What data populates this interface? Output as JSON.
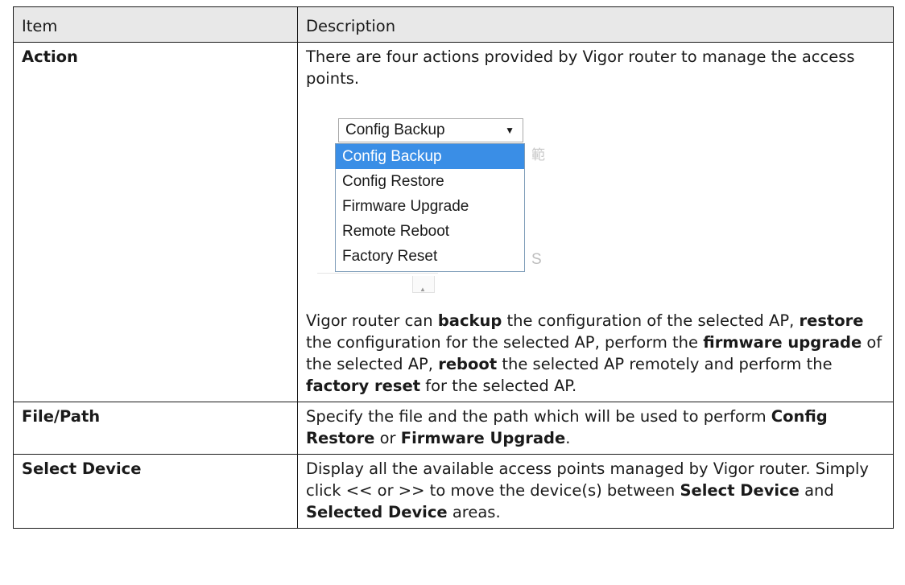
{
  "headers": {
    "item": "Item",
    "description": "Description"
  },
  "rows": {
    "action": {
      "item": "Action",
      "intro": "There are four actions provided by Vigor router to manage the access points.",
      "dropdown": {
        "selected": "Config Backup",
        "options": [
          "Config Backup",
          "Config Restore",
          "Firmware Upgrade",
          "Remote Reboot",
          "Factory Reset"
        ],
        "highlighted_index": 0,
        "arrow_icon": "triangle-down-icon",
        "background_fragments": [
          "範",
          "S"
        ]
      },
      "desc": {
        "t1": "Vigor router can ",
        "b1": "backup",
        "t2": " the configuration of the selected AP, ",
        "b2": "restore",
        "t3": " the configuration for the selected AP, perform the ",
        "b3": "firmware upgrade",
        "t4": " of the selected AP, ",
        "b4": "reboot",
        "t5": " the selected AP remotely and perform the ",
        "b5": "factory reset",
        "t6": " for the selected AP."
      }
    },
    "file_path": {
      "item": "File/Path",
      "t1": "Specify the file and the path which will be used to perform ",
      "b1": "Config Restore",
      "t2": " or ",
      "b2": "Firmware Upgrade",
      "t3": "."
    },
    "select_device": {
      "item": "Select Device",
      "t1": "Display all the available access points managed by Vigor router. Simply click << or >> to move the device(s) between ",
      "b1": "Select Device",
      "t2": " and ",
      "b2": "Selected Device",
      "t3": " areas."
    }
  },
  "colors": {
    "header_bg": "#e8e8e8",
    "highlight": "#3a8ee6",
    "border": "#1a1a1a"
  }
}
